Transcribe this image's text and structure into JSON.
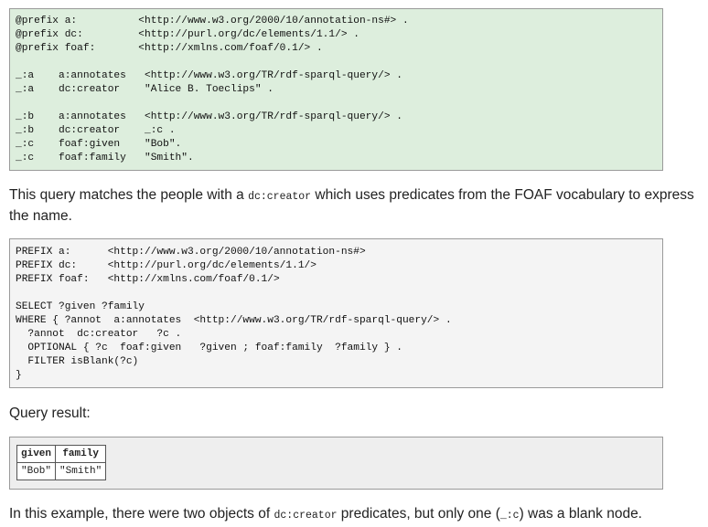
{
  "data_block": {
    "lines": [
      "@prefix a:          <http://www.w3.org/2000/10/annotation-ns#> .",
      "@prefix dc:         <http://purl.org/dc/elements/1.1/> .",
      "@prefix foaf:       <http://xmlns.com/foaf/0.1/> .",
      "",
      "_:a    a:annotates   <http://www.w3.org/TR/rdf-sparql-query/> .",
      "_:a    dc:creator    \"Alice B. Toeclips\" .",
      "",
      "_:b    a:annotates   <http://www.w3.org/TR/rdf-sparql-query/> .",
      "_:b    dc:creator    _:c .",
      "_:c    foaf:given    \"Bob\".",
      "_:c    foaf:family   \"Smith\"."
    ]
  },
  "paragraph1": {
    "before": "This query matches the people with a ",
    "code": "dc:creator",
    "after": " which uses predicates from the FOAF vocabulary to express the name."
  },
  "query_block": {
    "lines": [
      "PREFIX a:      <http://www.w3.org/2000/10/annotation-ns#>",
      "PREFIX dc:     <http://purl.org/dc/elements/1.1/>",
      "PREFIX foaf:   <http://xmlns.com/foaf/0.1/>",
      "",
      "SELECT ?given ?family",
      "WHERE { ?annot  a:annotates  <http://www.w3.org/TR/rdf-sparql-query/> .",
      "  ?annot  dc:creator   ?c .",
      "  OPTIONAL { ?c  foaf:given   ?given ; foaf:family  ?family } .",
      "  FILTER isBlank(?c)",
      "}"
    ]
  },
  "paragraph2": {
    "text": "Query result:"
  },
  "result_table": {
    "headers": [
      "given",
      "family"
    ],
    "rows": [
      [
        "\"Bob\"",
        "\"Smith\""
      ]
    ]
  },
  "paragraph3": {
    "before": "In this example, there were two objects of ",
    "code1": "dc:creator",
    "middle": " predicates, but only one (",
    "code2": "_:c",
    "after": ") was a blank node."
  }
}
